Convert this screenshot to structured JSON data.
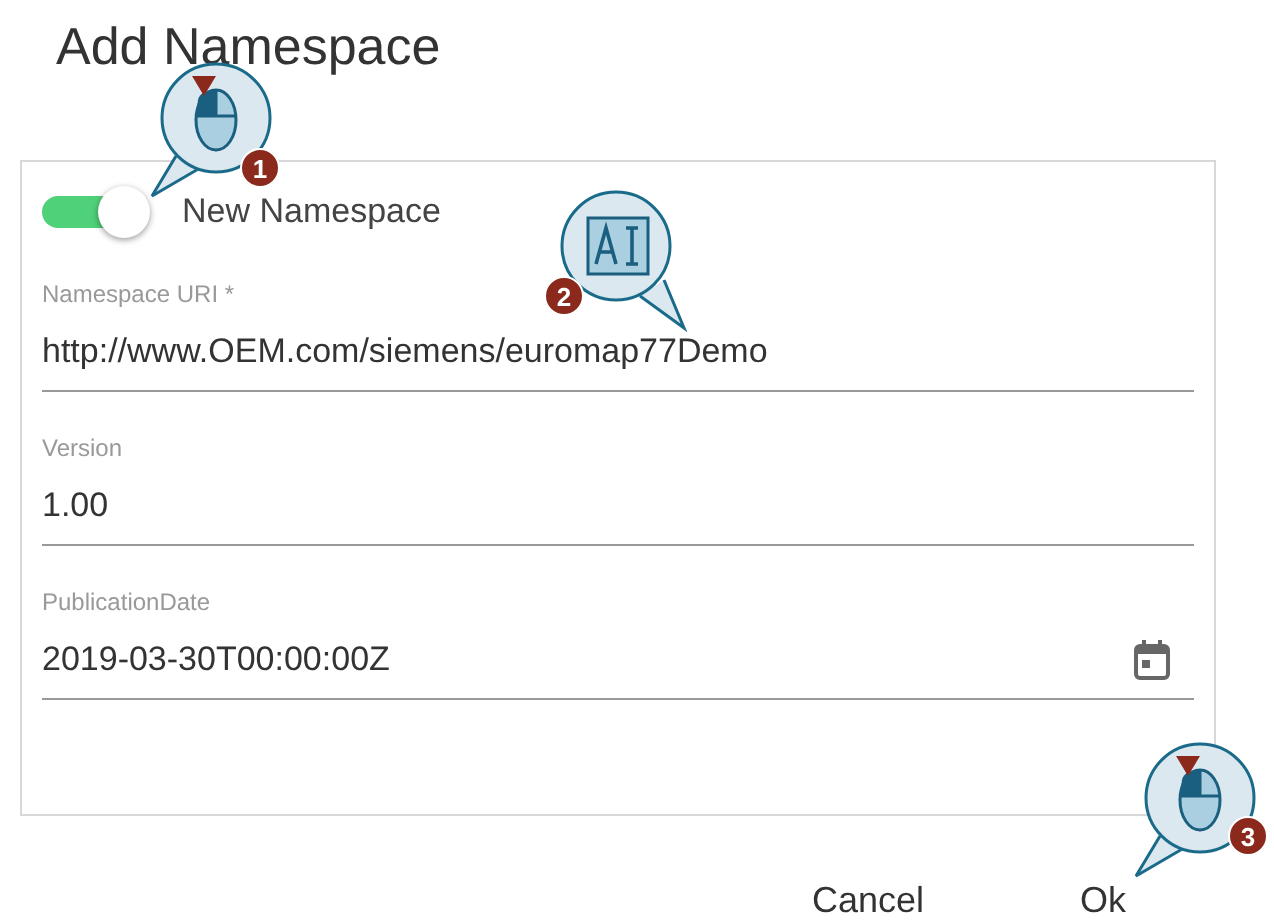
{
  "dialog": {
    "title": "Add Namespace"
  },
  "toggle": {
    "label": "New Namespace",
    "on": true
  },
  "fields": [
    {
      "label": "Namespace URI *",
      "value": "http://www.OEM.com/siemens/euromap77Demo",
      "kind": "text"
    },
    {
      "label": "Version",
      "value": "1.00",
      "kind": "text"
    },
    {
      "label": "PublicationDate",
      "value": "2019-03-30T00:00:00Z",
      "kind": "date"
    }
  ],
  "buttons": [
    "Cancel",
    "Ok"
  ],
  "callouts": [
    {
      "kind": "mouse",
      "number": "1"
    },
    {
      "kind": "text",
      "number": "2"
    },
    {
      "kind": "mouse",
      "number": "3"
    }
  ]
}
